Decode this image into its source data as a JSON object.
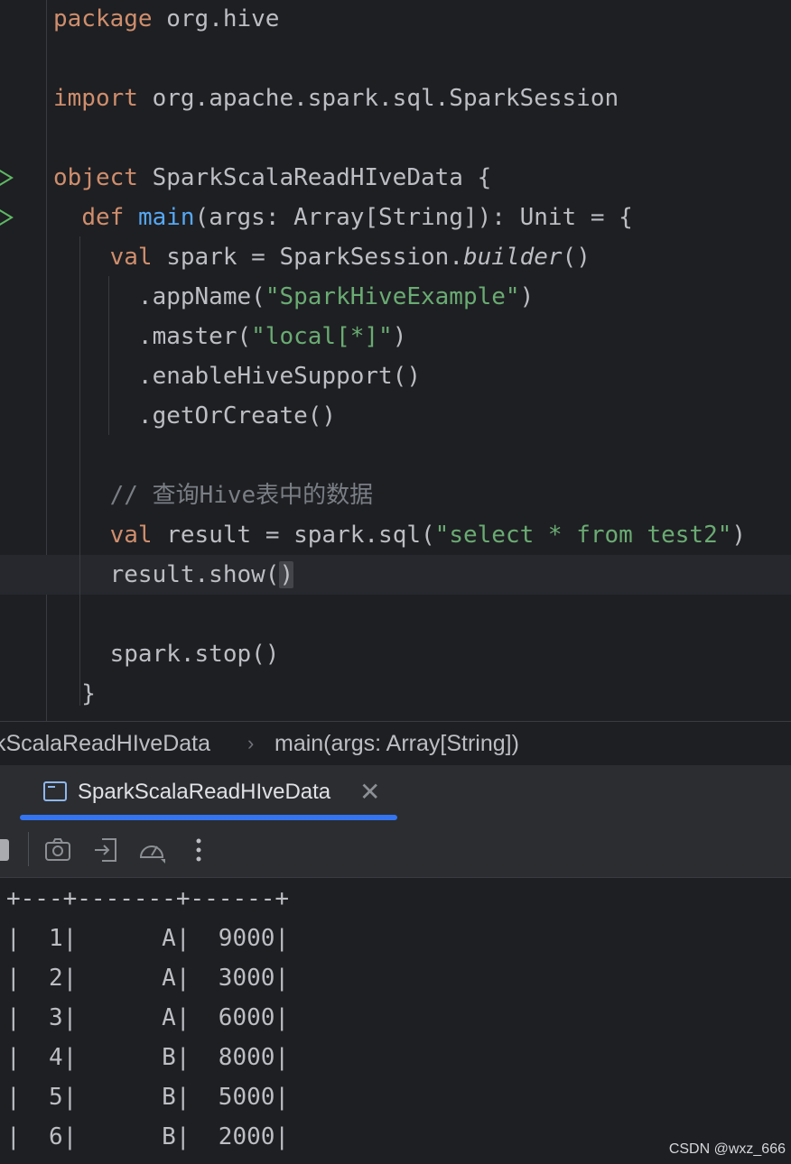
{
  "editor": {
    "lines": [
      {
        "parts": [
          {
            "t": "package",
            "c": "kw"
          },
          {
            "t": " org.hive"
          }
        ]
      },
      {
        "parts": []
      },
      {
        "parts": [
          {
            "t": "import",
            "c": "kw"
          },
          {
            "t": " org.apache.spark.sql.SparkSession"
          }
        ]
      },
      {
        "parts": []
      },
      {
        "parts": [
          {
            "t": "object",
            "c": "kw"
          },
          {
            "t": " SparkScalaReadHIveData {"
          }
        ],
        "run": true
      },
      {
        "parts": [
          {
            "t": "  "
          },
          {
            "t": "def",
            "c": "kw"
          },
          {
            "t": " "
          },
          {
            "t": "main",
            "c": "fn"
          },
          {
            "t": "(args: Array[String]): Unit = {"
          }
        ],
        "run": true
      },
      {
        "parts": [
          {
            "t": "    "
          },
          {
            "t": "val",
            "c": "kw"
          },
          {
            "t": " spark = SparkSession."
          },
          {
            "t": "builder",
            "c": "it"
          },
          {
            "t": "()"
          }
        ]
      },
      {
        "parts": [
          {
            "t": "      .appName("
          },
          {
            "t": "\"SparkHiveExample\"",
            "c": "str"
          },
          {
            "t": ")"
          }
        ]
      },
      {
        "parts": [
          {
            "t": "      .master("
          },
          {
            "t": "\"local[*]\"",
            "c": "str"
          },
          {
            "t": ")"
          }
        ]
      },
      {
        "parts": [
          {
            "t": "      .enableHiveSupport()"
          }
        ]
      },
      {
        "parts": [
          {
            "t": "      .getOrCreate()"
          }
        ]
      },
      {
        "parts": []
      },
      {
        "parts": [
          {
            "t": "    // 查询Hive表中的数据",
            "c": "cm"
          }
        ]
      },
      {
        "parts": [
          {
            "t": "    "
          },
          {
            "t": "val",
            "c": "kw"
          },
          {
            "t": " result = spark.sql("
          },
          {
            "t": "\"select * from test2\"",
            "c": "str"
          },
          {
            "t": ")"
          }
        ]
      },
      {
        "parts": [
          {
            "t": "    result.show("
          },
          {
            "t": ")",
            "c": "brace-hl"
          }
        ],
        "current": true
      },
      {
        "parts": []
      },
      {
        "parts": [
          {
            "t": "    spark.stop()"
          }
        ]
      },
      {
        "parts": [
          {
            "t": "  }"
          }
        ]
      }
    ]
  },
  "breadcrumb": {
    "object": "kScalaReadHIveData",
    "separator": "›",
    "method": "main(args: Array[String])"
  },
  "run_tab": {
    "label": "SparkScalaReadHIveData",
    "close": "✕"
  },
  "toolbar": {
    "icons": [
      "stop-icon",
      "screenshot-icon",
      "import-icon",
      "profiler-icon",
      "more-icon"
    ]
  },
  "console": {
    "lines": [
      "+---+-------+------+",
      "|  1|      A|  9000|",
      "|  2|      A|  3000|",
      "|  3|      A|  6000|",
      "|  4|      B|  8000|",
      "|  5|      B|  5000|",
      "|  6|      B|  2000|"
    ]
  },
  "watermark": "CSDN @wxz_666"
}
